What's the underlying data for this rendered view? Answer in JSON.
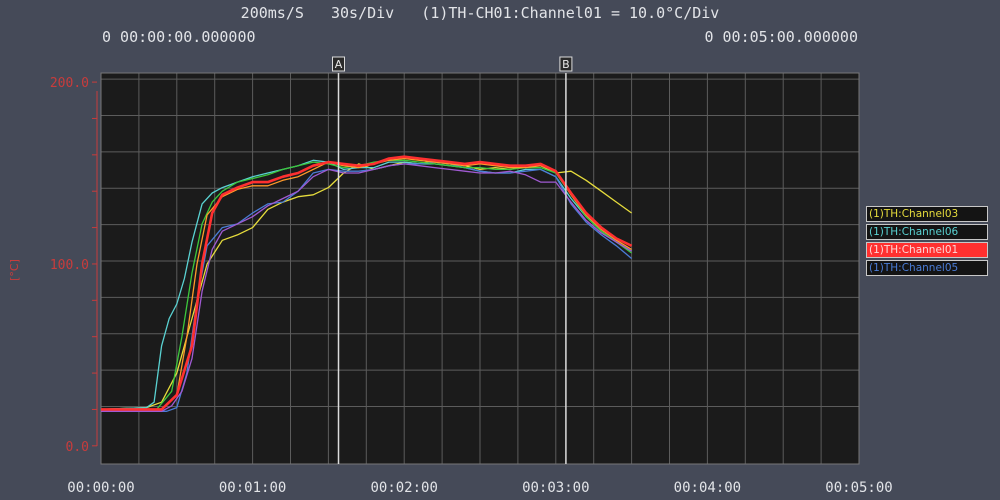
{
  "header": {
    "sample_rate": "200ms/S",
    "time_div": "30s/Div",
    "channel_info": "(1)TH-CH01:Channel01 = 10.0°C/Div",
    "start_time": "0 00:00:00.000000",
    "end_time": "0 00:05:00.000000"
  },
  "cursors": [
    {
      "label": "A",
      "time": "00:01:34"
    },
    {
      "label": "B",
      "time": "00:03:04"
    }
  ],
  "colors": {
    "background": "#454a58",
    "plot_bg": "#1b1b1b",
    "grid": "#5c5c5c",
    "axis_red": "#c83c3c",
    "text": "#e2e4e8"
  },
  "chart_data": {
    "type": "line",
    "xlabel": "",
    "ylabel": "[°C]",
    "xlim": [
      0,
      300
    ],
    "ylim": [
      -10,
      205
    ],
    "x_ticks": [
      {
        "value": 0,
        "label": "00:00:00"
      },
      {
        "value": 60,
        "label": "00:01:00"
      },
      {
        "value": 120,
        "label": "00:02:00"
      },
      {
        "value": 180,
        "label": "00:03:00"
      },
      {
        "value": 240,
        "label": "00:04:00"
      },
      {
        "value": 300,
        "label": "00:05:00"
      }
    ],
    "y_ticks": [
      {
        "value": 0,
        "label": "0.0"
      },
      {
        "value": 100,
        "label": "100.0"
      },
      {
        "value": 200,
        "label": "200.0"
      }
    ],
    "series": [
      {
        "name": "(1)TH:Channel03",
        "color": "#e6dc3c",
        "bold": false,
        "x": [
          0,
          18,
          24,
          30,
          36,
          42,
          48,
          54,
          60,
          66,
          72,
          78,
          84,
          90,
          96,
          102,
          108,
          114,
          120,
          126,
          132,
          138,
          144,
          150,
          156,
          162,
          168,
          174,
          180,
          186,
          192,
          198,
          204,
          210
        ],
        "y": [
          20,
          21,
          24,
          40,
          70,
          100,
          113,
          116,
          120,
          130,
          134,
          137,
          138,
          142,
          150,
          155,
          152,
          154,
          156,
          155,
          157,
          156,
          154,
          152,
          153,
          152,
          154,
          154,
          150,
          151,
          146,
          140,
          134,
          128
        ]
      },
      {
        "name": "(1)TH:Channel06",
        "color": "#5ad2d2",
        "bold": false,
        "x": [
          0,
          18,
          21,
          24,
          27,
          30,
          33,
          36,
          40,
          44,
          48,
          54,
          60,
          66,
          72,
          78,
          84,
          90,
          96,
          102,
          108,
          114,
          120,
          126,
          132,
          138,
          144,
          150,
          156,
          162,
          168,
          174,
          180,
          186,
          192,
          198,
          204,
          210
        ],
        "y": [
          20,
          21,
          24,
          55,
          70,
          78,
          92,
          112,
          133,
          139,
          142,
          145,
          148,
          150,
          152,
          154,
          157,
          156,
          152,
          153,
          153,
          156,
          156,
          155,
          155,
          154,
          153,
          151,
          150,
          150,
          152,
          152,
          148,
          136,
          126,
          118,
          112,
          107
        ]
      },
      {
        "name": "(1)TH:Channel01",
        "color": "#ff3030",
        "bold": true,
        "x": [
          0,
          24,
          30,
          36,
          40,
          44,
          48,
          54,
          60,
          66,
          72,
          78,
          84,
          90,
          96,
          102,
          108,
          114,
          120,
          126,
          132,
          138,
          144,
          150,
          156,
          162,
          168,
          174,
          180,
          186,
          192,
          198,
          204,
          210
        ],
        "y": [
          20,
          20,
          28,
          55,
          100,
          128,
          138,
          142,
          145,
          145,
          148,
          150,
          154,
          156,
          155,
          154,
          155,
          158,
          159,
          158,
          157,
          156,
          155,
          156,
          155,
          154,
          154,
          155,
          151,
          139,
          128,
          120,
          114,
          110
        ]
      },
      {
        "name": "(1)TH:Channel05",
        "color": "#4a7cd6",
        "bold": false,
        "x": [
          0,
          26,
          30,
          34,
          38,
          42,
          48,
          54,
          60,
          66,
          72,
          78,
          84,
          90,
          96,
          102,
          108,
          114,
          120,
          126,
          132,
          138,
          144,
          150,
          156,
          162,
          168,
          174,
          180,
          186,
          192,
          198,
          204,
          210
        ],
        "y": [
          19,
          19,
          21,
          40,
          80,
          110,
          120,
          122,
          128,
          133,
          134,
          140,
          150,
          152,
          151,
          151,
          152,
          154,
          155,
          155,
          156,
          155,
          153,
          151,
          150,
          150,
          151,
          152,
          148,
          133,
          123,
          116,
          110,
          103
        ]
      },
      {
        "name": "",
        "color": "#3cc83c",
        "bold": false,
        "x": [
          0,
          22,
          28,
          32,
          36,
          40,
          44,
          48,
          54,
          60,
          66,
          72,
          78,
          84,
          90,
          96,
          102,
          108,
          114,
          120,
          126,
          132,
          138,
          144,
          150,
          156,
          162,
          168,
          174,
          180,
          186,
          192,
          198,
          204,
          210
        ],
        "y": [
          20,
          20,
          30,
          60,
          95,
          122,
          134,
          140,
          145,
          147,
          149,
          152,
          154,
          156,
          155,
          153,
          154,
          156,
          157,
          157,
          156,
          155,
          154,
          153,
          153,
          152,
          152,
          153,
          153,
          150,
          138,
          126,
          118,
          112,
          106
        ]
      },
      {
        "name": "",
        "color": "#ff9a2a",
        "bold": false,
        "x": [
          0,
          24,
          30,
          34,
          38,
          42,
          48,
          54,
          60,
          66,
          72,
          78,
          84,
          90,
          96,
          102,
          108,
          114,
          120,
          126,
          132,
          138,
          144,
          150,
          156,
          162,
          168,
          174,
          180,
          186,
          192,
          198,
          204,
          210
        ],
        "y": [
          20,
          20,
          28,
          60,
          100,
          127,
          137,
          141,
          143,
          143,
          146,
          148,
          152,
          156,
          154,
          153,
          155,
          157,
          158,
          157,
          156,
          155,
          154,
          155,
          154,
          153,
          153,
          154,
          151,
          138,
          127,
          119,
          113,
          108
        ]
      },
      {
        "name": "",
        "color": "#a05ad2",
        "bold": false,
        "x": [
          0,
          24,
          28,
          32,
          36,
          40,
          44,
          48,
          54,
          60,
          66,
          72,
          78,
          84,
          90,
          96,
          102,
          108,
          114,
          120,
          126,
          132,
          138,
          144,
          150,
          156,
          162,
          168,
          174,
          180,
          186,
          192,
          198,
          204,
          210
        ],
        "y": [
          19,
          19,
          22,
          30,
          48,
          85,
          108,
          118,
          122,
          126,
          132,
          136,
          140,
          148,
          152,
          150,
          150,
          152,
          154,
          155,
          154,
          153,
          152,
          151,
          150,
          150,
          151,
          149,
          145,
          145,
          134,
          124,
          117,
          112,
          107
        ]
      }
    ]
  }
}
